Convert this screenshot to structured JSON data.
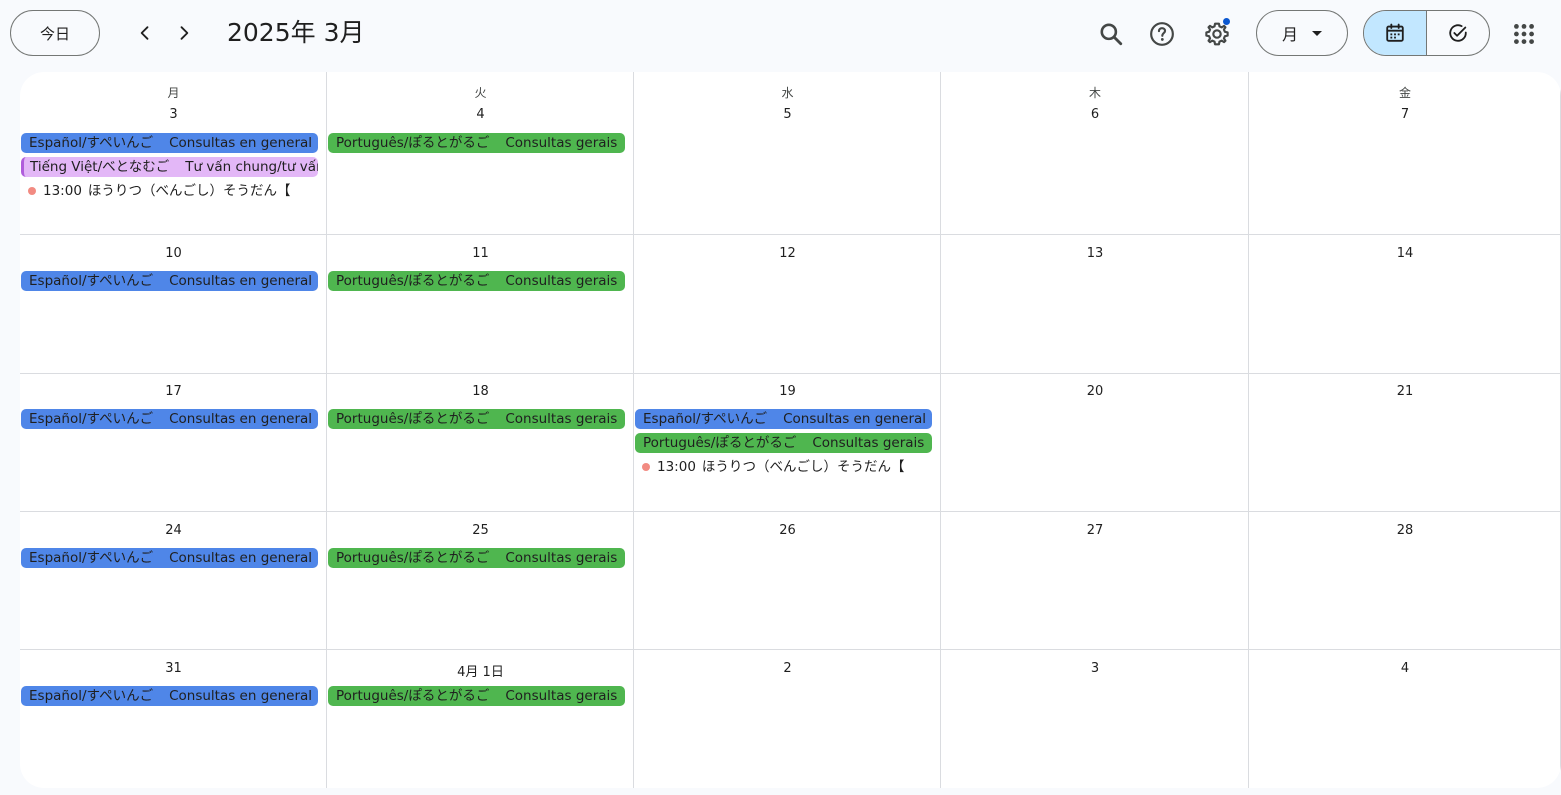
{
  "toolbar": {
    "today_label": "今日",
    "title": "2025年 3月",
    "view_label": "月",
    "icons": {
      "prev": "chevron-left-icon",
      "next": "chevron-right-icon",
      "search": "search-icon",
      "help": "help-icon",
      "settings": "gear-icon",
      "calendar": "calendar-icon",
      "tasks": "check-circle-icon",
      "apps": "apps-grid-icon"
    }
  },
  "colors": {
    "blue_event": "#4f86e8",
    "green_event": "#4fb64f",
    "purple_event": "#e3b7f7",
    "timed_dot": "#f28b82",
    "active_view": "#c2e7ff",
    "notification_dot": "#0b57d0"
  },
  "calendar": {
    "weekdays": [
      "月",
      "火",
      "水",
      "木",
      "金"
    ],
    "weeks": [
      {
        "days": [
          {
            "label": "3",
            "events": [
              {
                "kind": "allday",
                "color": "blue",
                "title": "Español/すぺいんご",
                "detail": "Consultas en general"
              },
              {
                "kind": "allday",
                "color": "purple",
                "title": "Tiếng Việt/べとなむご",
                "detail": "Tư vấn chung/tư vấn"
              },
              {
                "kind": "timed",
                "time": "13:00",
                "title": "ほうりつ（べんごし）そうだん【"
              }
            ]
          },
          {
            "label": "4",
            "events": [
              {
                "kind": "allday",
                "color": "green",
                "title": "Português/ぽるとがるご",
                "detail": "Consultas gerais"
              }
            ]
          },
          {
            "label": "5",
            "events": []
          },
          {
            "label": "6",
            "events": []
          },
          {
            "label": "7",
            "events": []
          }
        ]
      },
      {
        "days": [
          {
            "label": "10",
            "events": [
              {
                "kind": "allday",
                "color": "blue",
                "title": "Español/すぺいんご",
                "detail": "Consultas en general"
              }
            ]
          },
          {
            "label": "11",
            "events": [
              {
                "kind": "allday",
                "color": "green",
                "title": "Português/ぽるとがるご",
                "detail": "Consultas gerais"
              }
            ]
          },
          {
            "label": "12",
            "events": []
          },
          {
            "label": "13",
            "events": []
          },
          {
            "label": "14",
            "events": []
          }
        ]
      },
      {
        "days": [
          {
            "label": "17",
            "events": [
              {
                "kind": "allday",
                "color": "blue",
                "title": "Español/すぺいんご",
                "detail": "Consultas en general"
              }
            ]
          },
          {
            "label": "18",
            "events": [
              {
                "kind": "allday",
                "color": "green",
                "title": "Português/ぽるとがるご",
                "detail": "Consultas gerais"
              }
            ]
          },
          {
            "label": "19",
            "events": [
              {
                "kind": "allday",
                "color": "blue",
                "title": "Español/すぺいんご",
                "detail": "Consultas en general"
              },
              {
                "kind": "allday",
                "color": "green",
                "title": "Português/ぽるとがるご",
                "detail": "Consultas gerais"
              },
              {
                "kind": "timed",
                "time": "13:00",
                "title": "ほうりつ（べんごし）そうだん【"
              }
            ]
          },
          {
            "label": "20",
            "events": []
          },
          {
            "label": "21",
            "events": []
          }
        ]
      },
      {
        "days": [
          {
            "label": "24",
            "events": [
              {
                "kind": "allday",
                "color": "blue",
                "title": "Español/すぺいんご",
                "detail": "Consultas en general"
              }
            ]
          },
          {
            "label": "25",
            "events": [
              {
                "kind": "allday",
                "color": "green",
                "title": "Português/ぽるとがるご",
                "detail": "Consultas gerais"
              }
            ]
          },
          {
            "label": "26",
            "events": []
          },
          {
            "label": "27",
            "events": []
          },
          {
            "label": "28",
            "events": []
          }
        ]
      },
      {
        "days": [
          {
            "label": "31",
            "events": [
              {
                "kind": "allday",
                "color": "blue",
                "title": "Español/すぺいんご",
                "detail": "Consultas en general"
              }
            ]
          },
          {
            "label": "4月 1日",
            "events": [
              {
                "kind": "allday",
                "color": "green",
                "title": "Português/ぽるとがるご",
                "detail": "Consultas gerais"
              }
            ]
          },
          {
            "label": "2",
            "events": []
          },
          {
            "label": "3",
            "events": []
          },
          {
            "label": "4",
            "events": []
          }
        ]
      }
    ]
  }
}
